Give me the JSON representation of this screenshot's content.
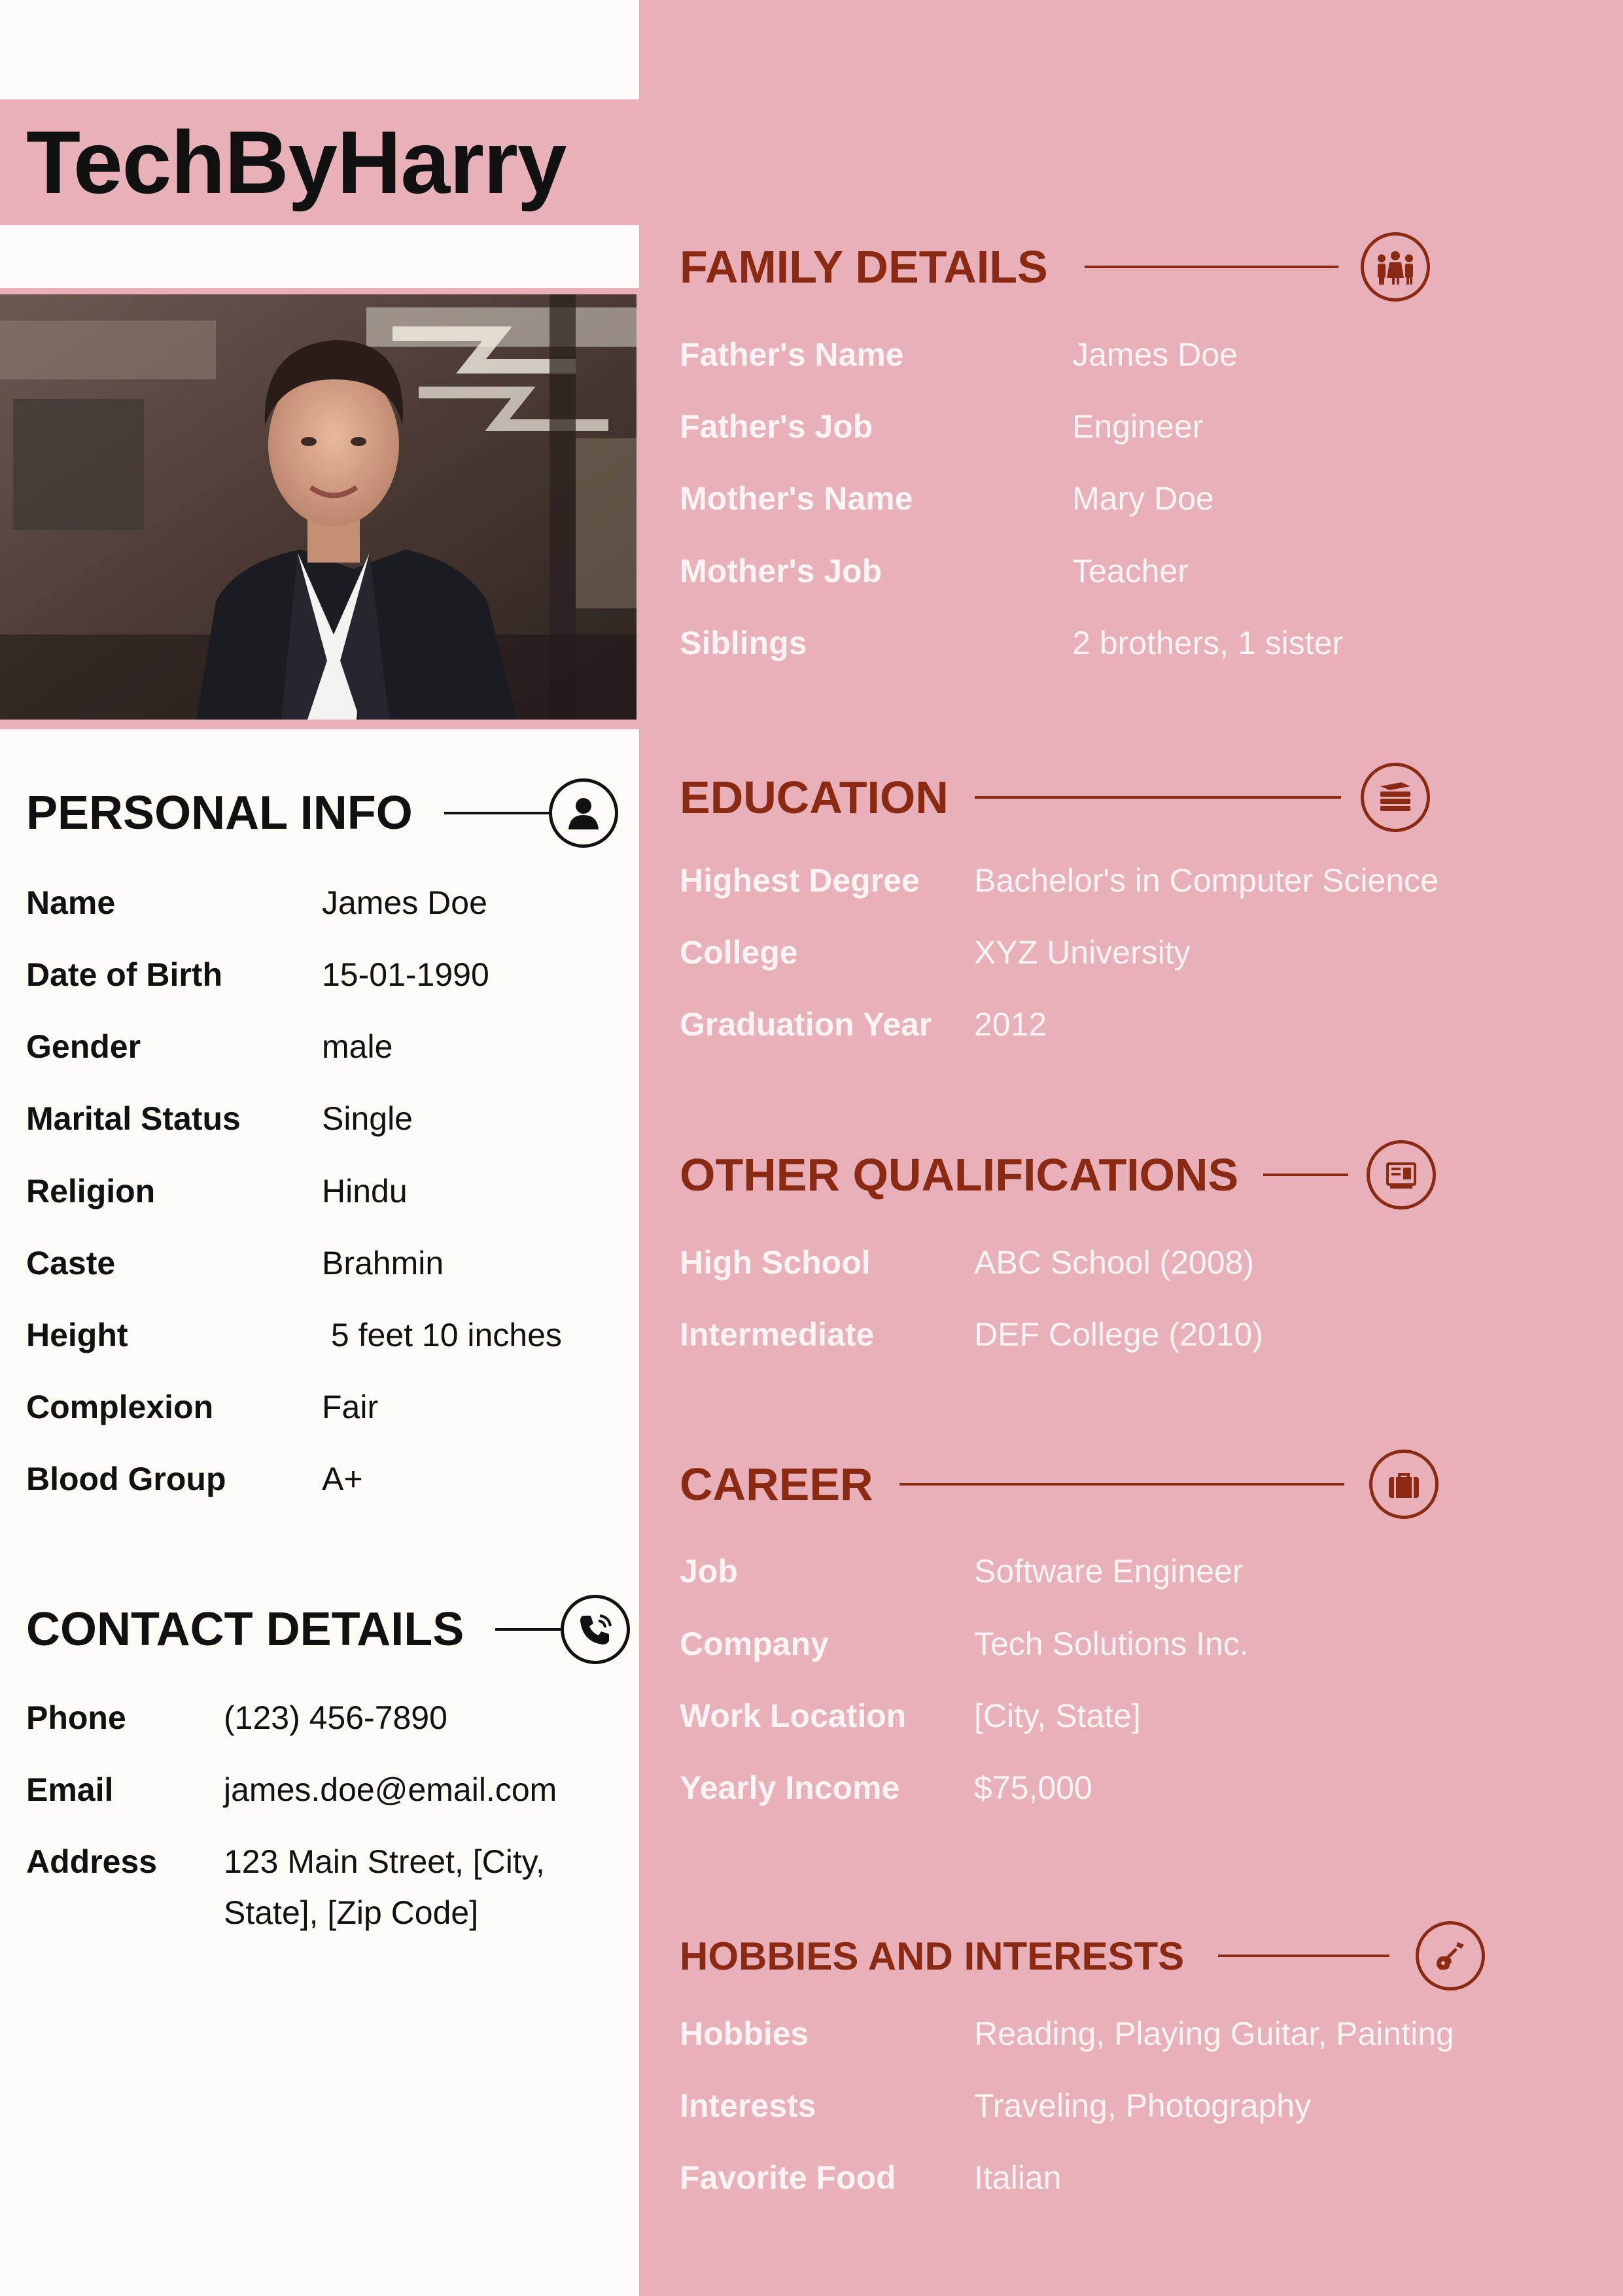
{
  "brand": "TechByHarry",
  "colors": {
    "pink": "#e8b0b9",
    "cream": "#fdfbf5",
    "maroon": "#8b2a12",
    "text": "#111111",
    "light_text": "#fff3f4"
  },
  "personal": {
    "title": "PERSONAL INFO",
    "icon": "person-icon",
    "rows": [
      {
        "label": "Name",
        "value": "James Doe"
      },
      {
        "label": "Date of Birth",
        "value": "15-01-1990"
      },
      {
        "label": "Gender",
        "value": "male"
      },
      {
        "label": "Marital Status",
        "value": "Single"
      },
      {
        "label": "Religion",
        "value": "Hindu"
      },
      {
        "label": "Caste",
        "value": "Brahmin"
      },
      {
        "label": "Height",
        "value": " 5 feet 10 inches"
      },
      {
        "label": "Complexion",
        "value": "Fair"
      },
      {
        "label": "Blood Group",
        "value": "A+"
      }
    ]
  },
  "contact": {
    "title": "CONTACT DETAILS",
    "icon": "phone-icon",
    "rows": [
      {
        "label": "Phone",
        "value": "(123) 456-7890"
      },
      {
        "label": "Email",
        "value": "james.doe@email.com"
      },
      {
        "label": "Address",
        "value": "123 Main Street, [City,",
        "value2": "State], [Zip Code]"
      }
    ]
  },
  "family": {
    "title": "FAMILY DETAILS",
    "icon": "family-icon",
    "rows": [
      {
        "label": "Father's Name",
        "value": "James Doe"
      },
      {
        "label": "Father's Job",
        "value": "Engineer"
      },
      {
        "label": "Mother's Name",
        "value": "Mary Doe"
      },
      {
        "label": "Mother's Job",
        "value": "Teacher"
      },
      {
        "label": "Siblings",
        "value": "2 brothers, 1 sister"
      }
    ]
  },
  "education": {
    "title": "EDUCATION",
    "icon": "books-icon",
    "rows": [
      {
        "label": "Highest Degree",
        "value": "Bachelor's in Computer Science"
      },
      {
        "label": "College",
        "value": "XYZ University"
      },
      {
        "label": "Graduation Year",
        "value": "2012"
      }
    ]
  },
  "other": {
    "title": "OTHER QUALIFICATIONS",
    "icon": "certificate-icon",
    "rows": [
      {
        "label": "High School",
        "value": "ABC School (2008)"
      },
      {
        "label": "Intermediate",
        "value": "DEF College (2010)"
      }
    ]
  },
  "career": {
    "title": "CAREER",
    "icon": "briefcase-icon",
    "rows": [
      {
        "label": "Job",
        "value": "Software Engineer"
      },
      {
        "label": "Company",
        "value": "Tech Solutions Inc."
      },
      {
        "label": "Work Location",
        "value": "[City, State]"
      },
      {
        "label": "Yearly Income",
        "value": "$75,000"
      }
    ]
  },
  "hobbies": {
    "title": "HOBBIES AND INTERESTS",
    "icon": "guitar-icon",
    "rows": [
      {
        "label": "Hobbies",
        "value": "Reading, Playing Guitar, Painting"
      },
      {
        "label": "Interests",
        "value": "Traveling, Photography"
      },
      {
        "label": "Favorite Food",
        "value": "Italian"
      }
    ]
  }
}
